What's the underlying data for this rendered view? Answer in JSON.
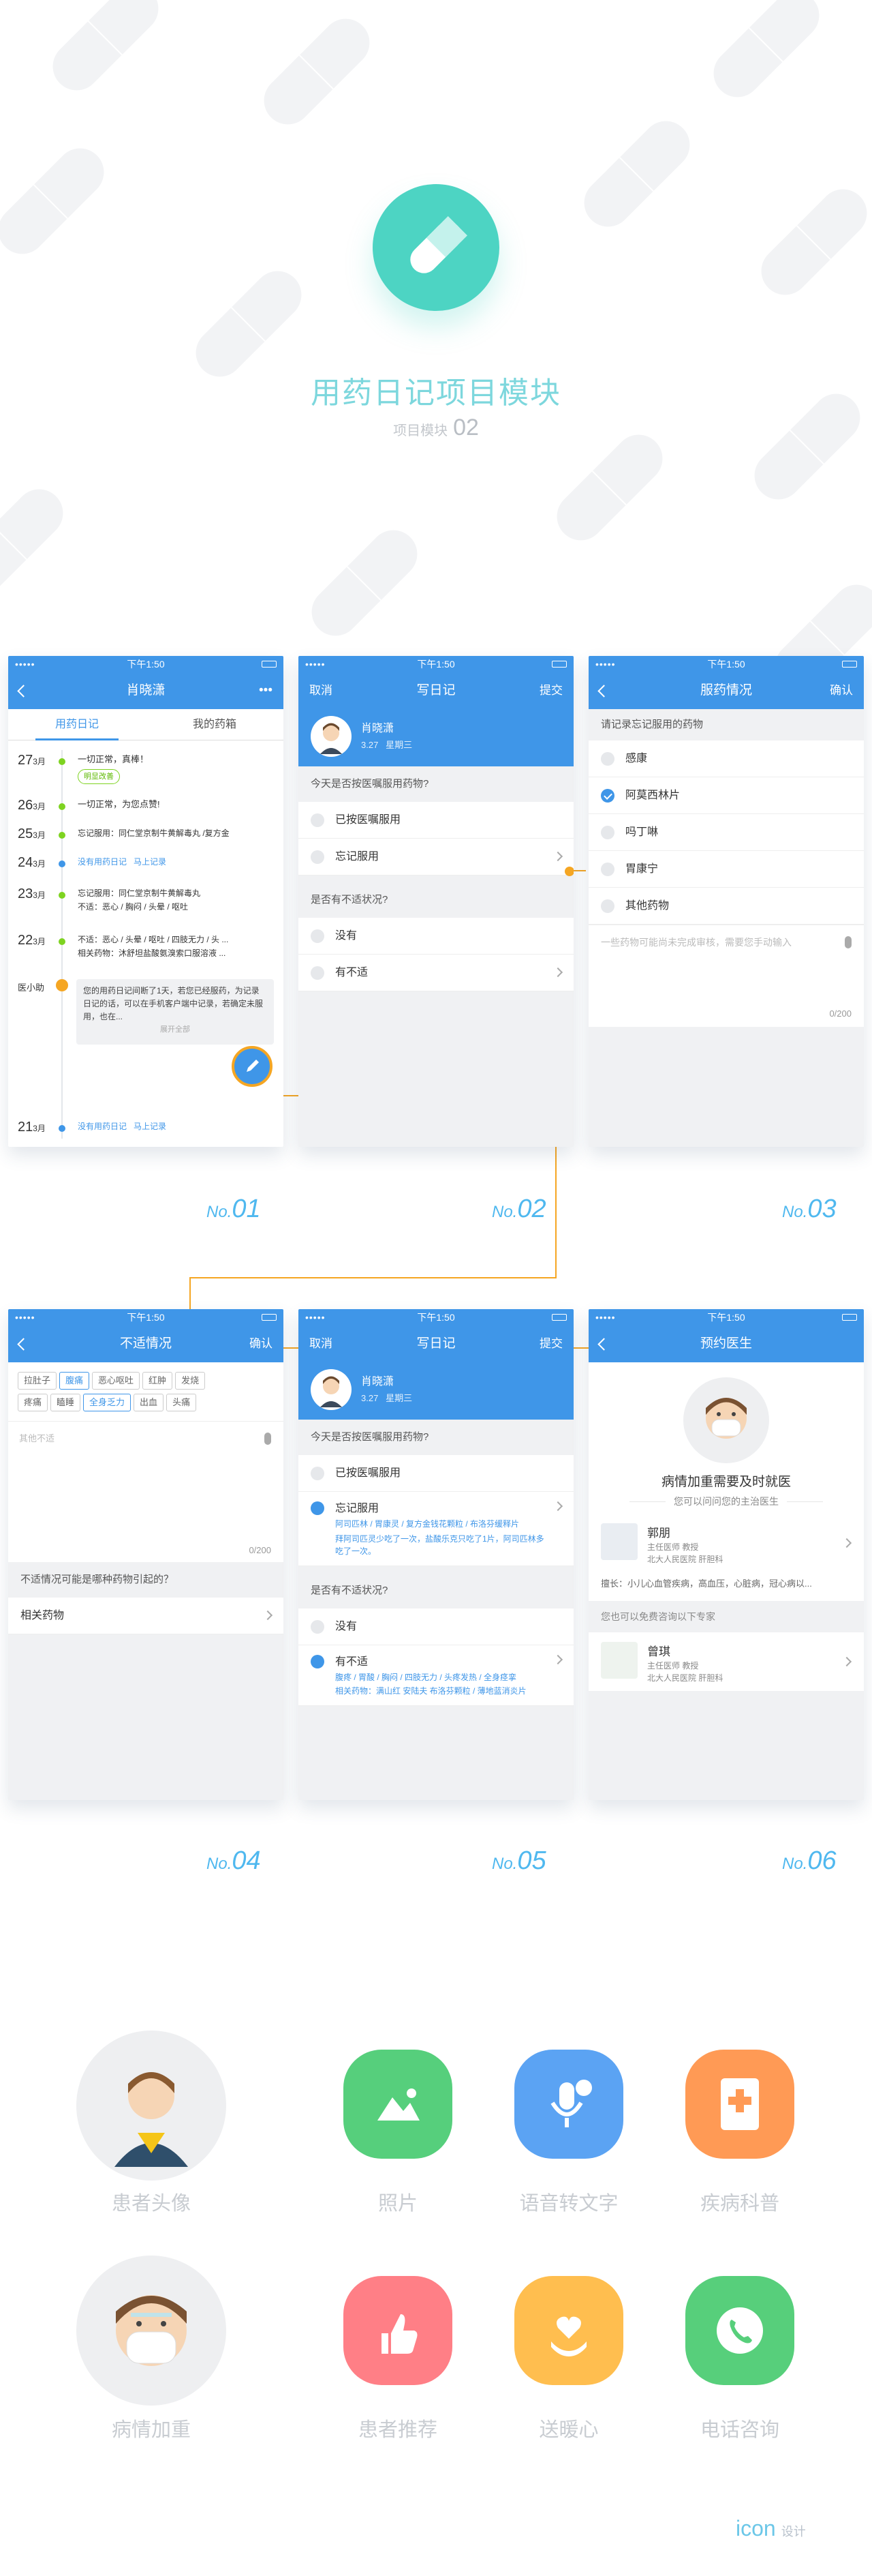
{
  "hero": {
    "title": "用药日记项目模块",
    "sub_label": "项目模块",
    "sub_num": "02"
  },
  "statusbar": {
    "time": "下午1:50",
    "dots": "•••••"
  },
  "p1": {
    "title": "肖晓潇",
    "more": "•••",
    "tab1": "用药日记",
    "tab2": "我的药箱",
    "timeline": [
      {
        "day": "27",
        "mon": "3月",
        "text": "一切正常，真棒！",
        "badge": "明显改善"
      },
      {
        "day": "26",
        "mon": "3月",
        "text": "一切正常，为您点赞!"
      },
      {
        "day": "25",
        "mon": "3月",
        "text": "忘记服用：同仁堂京制牛黄解毒丸 /复方金"
      },
      {
        "day": "24",
        "mon": "3月",
        "text": "没有用药日记",
        "link": "马上记录"
      },
      {
        "day": "23",
        "mon": "3月",
        "text": "忘记服用：同仁堂京制牛黄解毒丸",
        "text2": "不适：恶心 / 胸闷 / 头晕 / 呕吐"
      },
      {
        "day": "22",
        "mon": "3月",
        "text": "不适：恶心 / 头晕 / 呕吐 / 四肢无力 / 头 ...",
        "text2": "相关药物：沐舒坦盐酸氨溴索口服溶液 ..."
      },
      {
        "day": "21",
        "mon": "3月",
        "text": "没有用药日记",
        "link": "马上记录"
      }
    ],
    "helper_name": "医小助",
    "helper_msg": "您的用药日记间断了1天，若您已经服药，为记录日记的话，可以在手机客户端中记录，若确定未服用，也在...",
    "helper_more": "展开全部"
  },
  "p2": {
    "cancel": "取消",
    "title": "写日记",
    "submit": "提交",
    "user": "肖晓潇",
    "date": "3.27",
    "weekday": "星期三",
    "q1": "今天是否按医嘱服用药物?",
    "q1a": "已按医嘱服用",
    "q1b": "忘记服用",
    "q2": "是否有不适状况?",
    "q2a": "没有",
    "q2b": "有不适"
  },
  "p3": {
    "title": "服药情况",
    "confirm": "确认",
    "q": "请记录忘记服用的药物",
    "drugs": [
      "感康",
      "阿莫西林片",
      "吗丁啉",
      "胃康宁",
      "其他药物"
    ],
    "placeholder": "一些药物可能尚未完成审核，需要您手动输入",
    "count": "0/200"
  },
  "p4": {
    "title": "不适情况",
    "confirm": "确认",
    "tags": [
      "拉肚子",
      "腹痛",
      "恶心呕吐",
      "红肿",
      "发烧",
      "疼痛",
      "瞌睡",
      "全身乏力",
      "出血",
      "头痛"
    ],
    "placeholder": "其他不适",
    "count": "0/200",
    "q": "不适情况可能是哪种药物引起的？",
    "related": "相关药物"
  },
  "p5": {
    "cancel": "取消",
    "title": "写日记",
    "submit": "提交",
    "user": "肖晓潇",
    "date": "3.27",
    "weekday": "星期三",
    "q1": "今天是否按医嘱服用药物?",
    "q1a": "已按医嘱服用",
    "q1b": "忘记服用",
    "q1b_detail": "阿司匹林 / 胃康灵 / 复方金钱花颗粒 / 布洛芬缓释片",
    "q1b_note": "拜阿司匹灵少吃了一次，盐酸乐克只吃了1片，阿司匹林多吃了一次。",
    "q2": "是否有不适状况?",
    "q2a": "没有",
    "q2b": "有不适",
    "q2b_detail": "腹疼 / 胃酸 / 胸闷 / 四肢无力 / 头疼发热 / 全身痉挛",
    "q2b_note": "相关药物：满山红 安陆夫 布洛芬颗粒 / 薄地蓝消炎片"
  },
  "p6": {
    "title": "预约医生",
    "headline": "病情加重需要及时就医",
    "sub": "您可以问问您的主治医生",
    "doc1": {
      "name": "郭朋",
      "title": "主任医师 教授",
      "hosp": "北大人民医院 肝胆科",
      "spec": "擅长：小儿心血管疾病，高血压，心脏病，冠心病以..."
    },
    "sub2": "您也可以免费咨询以下专家",
    "doc2": {
      "name": "曾琪",
      "title": "主任医师 教授",
      "hosp": "北大人民医院 肝胆科"
    }
  },
  "labels": {
    "n1": "01",
    "n2": "02",
    "n3": "03",
    "n4": "04",
    "n5": "05",
    "n6": "06",
    "no": "No."
  },
  "icons": {
    "patient": "患者头像",
    "photo": "照片",
    "voice": "语音转文字",
    "dept": "疾病科普",
    "worse": "病情加重",
    "recommend": "患者推荐",
    "warm": "送暖心",
    "call": "电话咨询"
  },
  "footer": {
    "icon": "icon",
    "design": "设计"
  },
  "colors": {
    "primary": "#3f96e8",
    "accent": "#f5a623",
    "mint": "#4dd4c3"
  }
}
